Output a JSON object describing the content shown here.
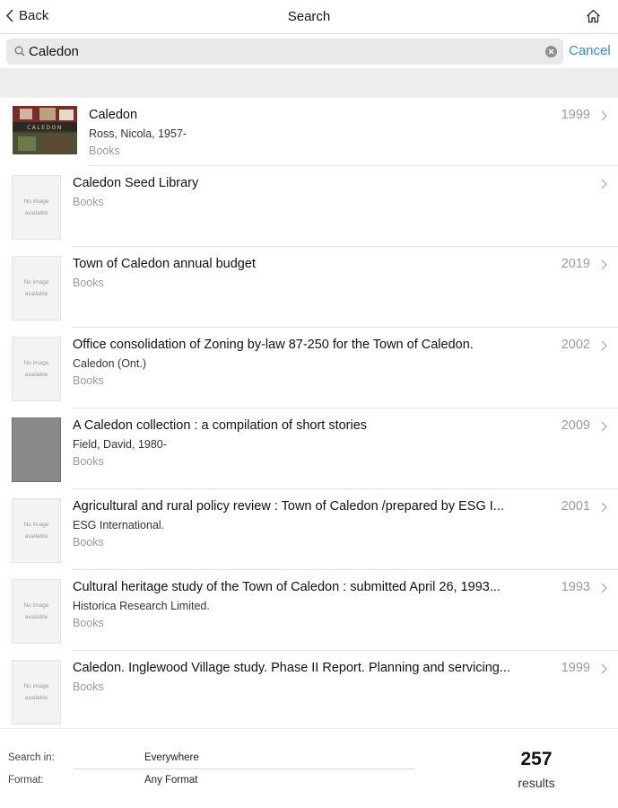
{
  "nav": {
    "back_label": "Back",
    "title": "Search"
  },
  "search": {
    "query": "Caledon",
    "cancel_label": "Cancel"
  },
  "results": [
    {
      "title": "Caledon",
      "author": "Ross, Nicola, 1957-",
      "format": "Books",
      "year": "1999",
      "thumb": "cover"
    },
    {
      "title": "Caledon Seed Library",
      "author": "",
      "format": "Books",
      "year": "",
      "thumb": "none"
    },
    {
      "title": "Town of Caledon annual budget",
      "author": "",
      "format": "Books",
      "year": "2019",
      "thumb": "none"
    },
    {
      "title": "Office consolidation of Zoning by-law 87-250 for the Town of Caledon.",
      "author": "Caledon (Ont.)",
      "format": "Books",
      "year": "2002",
      "thumb": "none"
    },
    {
      "title": "A Caledon collection : a compilation of short stories",
      "author": "Field, David, 1980-",
      "format": "Books",
      "year": "2009",
      "thumb": "gray"
    },
    {
      "title": "Agricultural and rural policy review : Town of Caledon /prepared by ESG I...",
      "author": "ESG International.",
      "format": "Books",
      "year": "2001",
      "thumb": "none"
    },
    {
      "title": "Cultural heritage study of the Town of Caledon : submitted April 26, 1993...",
      "author": "Historica Research Limited.",
      "format": "Books",
      "year": "1993",
      "thumb": "none"
    },
    {
      "title": "Caledon. Inglewood Village study. Phase II Report. Planning and servicing...",
      "author": "",
      "format": "Books",
      "year": "1999",
      "thumb": "none"
    }
  ],
  "no_image": {
    "line1": "No image",
    "line2": "available"
  },
  "cover_text": "CALEDON",
  "footer": {
    "search_in_label": "Search in:",
    "search_in_value": "Everywhere",
    "format_label": "Format:",
    "format_value": "Any Format",
    "count": "257",
    "count_label": "results"
  },
  "colors": {
    "accent": "#2f8ce6",
    "muted": "#9a9a9a",
    "section_bg": "#efeff1"
  },
  "icons": {
    "back": "chevron-left-icon",
    "home": "home-icon",
    "search": "magnifier-icon",
    "clear": "clear-circle-icon",
    "disclosure": "chevron-right-icon"
  }
}
